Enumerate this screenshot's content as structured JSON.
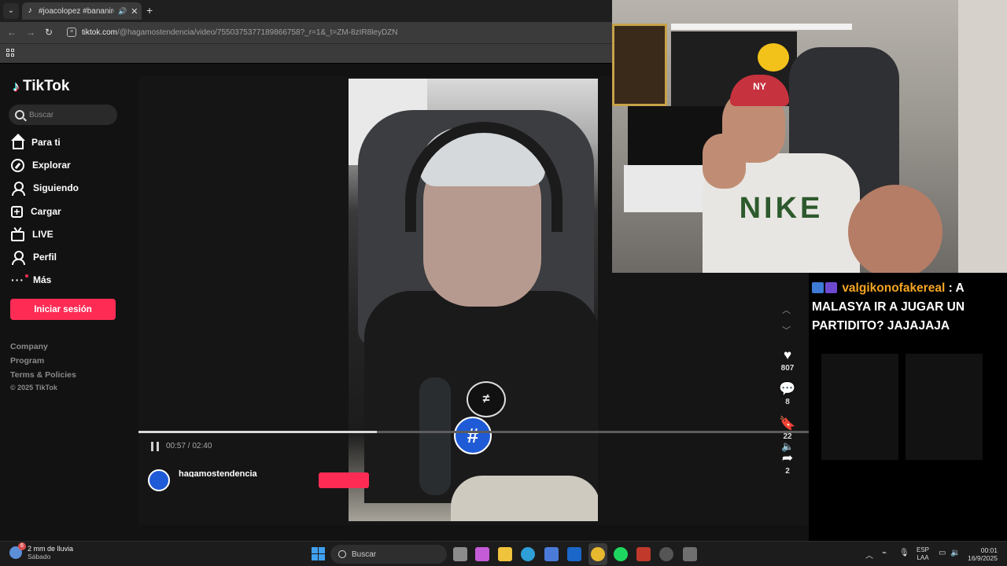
{
  "browser": {
    "tab_title": "#joacolopez #bananirou | b",
    "url_domain": "tiktok.com",
    "url_path": "/@hagamostendencia/video/7550375377189866758?_r=1&_t=ZM-8zIR8leyDZN"
  },
  "tiktok": {
    "logo_text": "TikTok",
    "search_placeholder": "Buscar",
    "nav": [
      {
        "label": "Para ti",
        "icon": "home-icon"
      },
      {
        "label": "Explorar",
        "icon": "compass-icon"
      },
      {
        "label": "Siguiendo",
        "icon": "following-icon"
      },
      {
        "label": "Cargar",
        "icon": "upload-icon"
      },
      {
        "label": "LIVE",
        "icon": "live-icon"
      },
      {
        "label": "Perfil",
        "icon": "profile-icon"
      },
      {
        "label": "Más",
        "icon": "more-icon"
      }
    ],
    "login_label": "Iniciar sesión",
    "footer_links": [
      "Company",
      "Program",
      "Terms & Policies"
    ],
    "copyright": "© 2025 TikTok",
    "player": {
      "time": "00:57 / 02:40",
      "progress": 0.356,
      "likes": "807",
      "comments": "8",
      "saves": "22",
      "shares": "2"
    },
    "author_handle": "hagamostendencia"
  },
  "stream_overlay": {
    "cap_text": "NY",
    "shirt_text": "NIKE",
    "chat": {
      "username": "valgikonofakereal",
      "separator": ":",
      "message": "A MALASYA IR A JUGAR UN PARTIDITO? JAJAJAJA"
    }
  },
  "taskbar": {
    "weather_badge": "6",
    "weather_main": "2 mm de lluvia",
    "weather_sub": "Sábado",
    "search_label": "Buscar",
    "lang_line1": "ESP",
    "lang_line2": "LAA",
    "time": "00:01",
    "date": "16/9/2025"
  },
  "colors": {
    "tiktok_pink": "#fe2c55",
    "chat_username": "#f5a623",
    "windows_blue": "#3fa0f0"
  }
}
